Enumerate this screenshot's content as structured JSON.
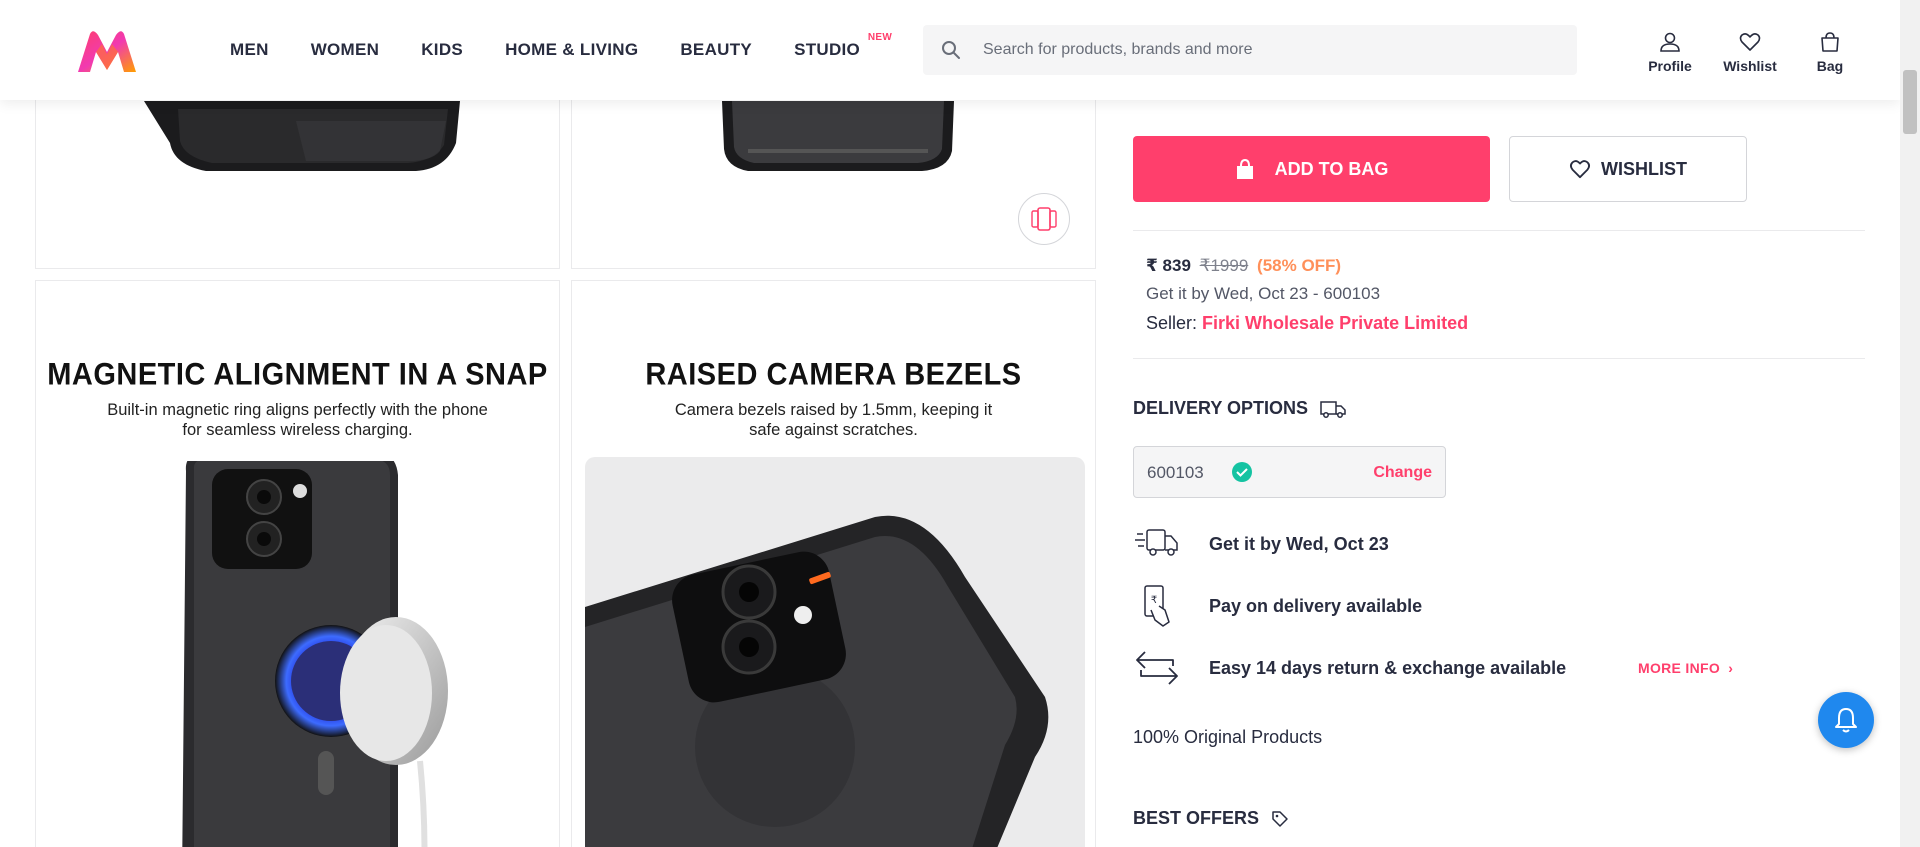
{
  "header": {
    "nav": [
      {
        "label": "MEN"
      },
      {
        "label": "WOMEN"
      },
      {
        "label": "KIDS"
      },
      {
        "label": "HOME & LIVING"
      },
      {
        "label": "BEAUTY"
      },
      {
        "label": "STUDIO",
        "badge": "NEW"
      }
    ],
    "search": {
      "placeholder": "Search for products, brands and more",
      "value": ""
    },
    "actions": [
      {
        "label": "Profile",
        "icon": "user-icon"
      },
      {
        "label": "Wishlist",
        "icon": "heart-icon"
      },
      {
        "label": "Bag",
        "icon": "bag-icon"
      }
    ]
  },
  "gallery": {
    "tiles": [
      {
        "title": "MAGNETIC ALIGNMENT IN A SNAP",
        "subtitle_lines": [
          "Built-in magnetic ring aligns perfectly with the phone",
          "for seamless wireless charging."
        ]
      },
      {
        "title": "RAISED CAMERA BEZELS",
        "subtitle_lines": [
          "Camera bezels raised by 1.5mm, keeping it",
          "safe against scratches."
        ]
      }
    ]
  },
  "product": {
    "add_to_bag": "ADD TO BAG",
    "wishlist": "WISHLIST",
    "price": "₹ 839",
    "mrp": "₹1999",
    "discount": "(58% OFF)",
    "delivery_eta": "Get it by Wed, Oct 23 - 600103",
    "seller_label": "Seller:",
    "seller_name": "Firki Wholesale Private Limited"
  },
  "delivery": {
    "title": "DELIVERY OPTIONS",
    "pincode": "600103",
    "change": "Change",
    "items": [
      {
        "text": "Get it by Wed, Oct 23",
        "icon": "delivery-truck-icon"
      },
      {
        "text": "Pay on delivery available",
        "icon": "cash-payment-icon"
      },
      {
        "text": "Easy 14 days return & exchange available",
        "icon": "return-exchange-icon"
      }
    ],
    "more_info": "MORE INFO",
    "original": "100% Original Products"
  },
  "offers": {
    "title": "BEST OFFERS"
  },
  "colors": {
    "brand_pink": "#ff3f6c",
    "discount_orange": "#ff905a",
    "notify_blue": "#1f88ee",
    "success_green": "#14958f"
  }
}
